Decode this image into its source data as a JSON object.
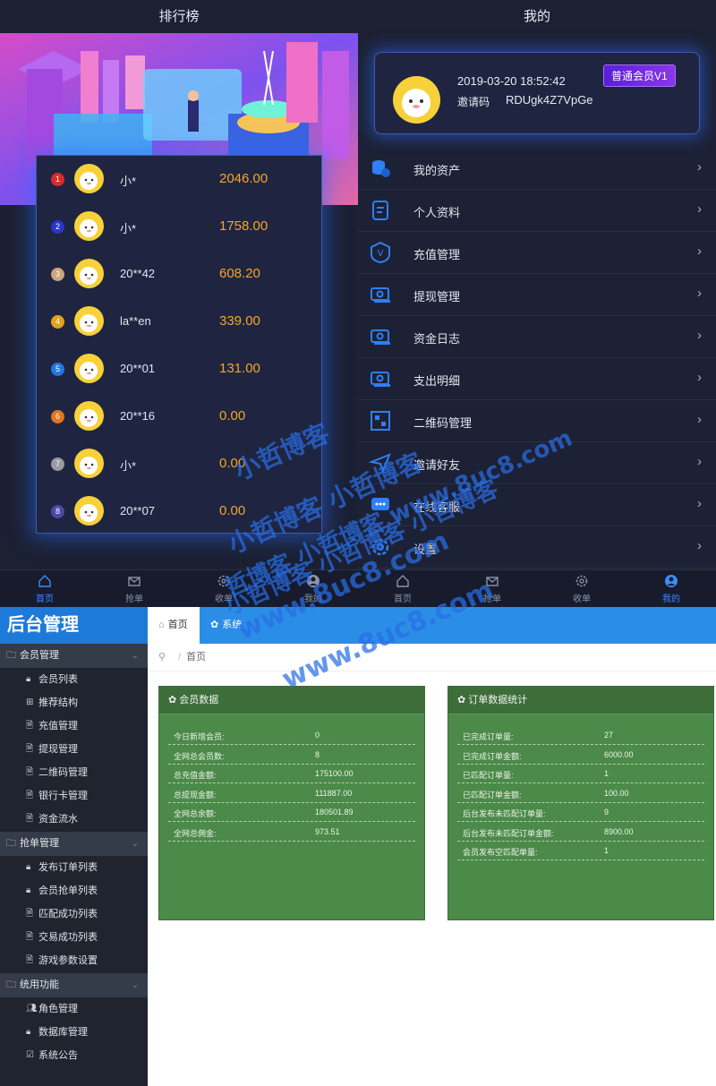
{
  "left_panel": {
    "title": "排行榜",
    "ranking": [
      {
        "rank": "1",
        "name": "小*",
        "amount": "2046.00",
        "badge_color": "#d92b2b"
      },
      {
        "rank": "2",
        "name": "小*",
        "amount": "1758.00",
        "badge_color": "#2a36c9"
      },
      {
        "rank": "3",
        "name": "20**42",
        "amount": "608.20",
        "badge_color": "#c9a57a"
      },
      {
        "rank": "4",
        "name": "la**en",
        "amount": "339.00",
        "badge_color": "#e3a21c"
      },
      {
        "rank": "5",
        "name": "20**01",
        "amount": "131.00",
        "badge_color": "#2577e3"
      },
      {
        "rank": "6",
        "name": "20**16",
        "amount": "0.00",
        "badge_color": "#e0761f"
      },
      {
        "rank": "7",
        "name": "小*",
        "amount": "0.00",
        "badge_color": "#9a9aa4"
      },
      {
        "rank": "8",
        "name": "20**07",
        "amount": "0.00",
        "badge_color": "#4b4aa8"
      }
    ]
  },
  "right_panel": {
    "title": "我的",
    "profile": {
      "datetime": "2019-03-20 18:52:42",
      "invite_label": "邀请码",
      "invite_code": "RDUgk4Z7VpGe",
      "vip": "普通会员V1"
    },
    "menu": [
      {
        "label": "我的资产",
        "icon": "coins-icon"
      },
      {
        "label": "个人资料",
        "icon": "document-icon"
      },
      {
        "label": "充值管理",
        "icon": "shield-v-icon"
      },
      {
        "label": "提现管理",
        "icon": "cash-icon"
      },
      {
        "label": "资金日志",
        "icon": "cash-icon"
      },
      {
        "label": "支出明细",
        "icon": "cash-icon"
      },
      {
        "label": "二维码管理",
        "icon": "qrcode-icon"
      },
      {
        "label": "邀请好友",
        "icon": "send-icon"
      },
      {
        "label": "在线客服",
        "icon": "chat-icon"
      },
      {
        "label": "设置",
        "icon": "gear-icon"
      }
    ],
    "arrow": "›"
  },
  "tabbar": [
    {
      "label": "首页",
      "icon": "home-icon",
      "active": true
    },
    {
      "label": "抢单",
      "icon": "mail-icon",
      "active": false
    },
    {
      "label": "收单",
      "icon": "gear-icon",
      "active": false
    },
    {
      "label": "我的",
      "icon": "user-icon",
      "active": false
    },
    {
      "label": "首页",
      "icon": "home-icon",
      "active": false
    },
    {
      "label": "抢单",
      "icon": "mail-icon",
      "active": false
    },
    {
      "label": "收单",
      "icon": "gear-icon",
      "active": false
    },
    {
      "label": "我的",
      "icon": "user-icon",
      "active": true
    }
  ],
  "admin": {
    "logo": "后台管理",
    "sidebar": [
      {
        "group": "会员管理",
        "items": [
          {
            "label": "会员列表",
            "icon": "lock-icon"
          },
          {
            "label": "推荐结构",
            "icon": "grid-icon"
          },
          {
            "label": "充值管理",
            "icon": "file-icon"
          },
          {
            "label": "提现管理",
            "icon": "file-icon"
          },
          {
            "label": "二维码管理",
            "icon": "file-icon"
          },
          {
            "label": "银行卡管理",
            "icon": "file-icon"
          },
          {
            "label": "资金流水",
            "icon": "file-icon"
          }
        ]
      },
      {
        "group": "抢单管理",
        "items": [
          {
            "label": "发布订单列表",
            "icon": "lock-icon"
          },
          {
            "label": "会员抢单列表",
            "icon": "lock-icon"
          },
          {
            "label": "匹配成功列表",
            "icon": "file-icon"
          },
          {
            "label": "交易成功列表",
            "icon": "file-icon"
          },
          {
            "label": "游戏参数设置",
            "icon": "file-icon"
          }
        ]
      },
      {
        "group": "统用功能",
        "items": [
          {
            "label": "角色管理",
            "icon": "users-icon"
          },
          {
            "label": "数据库管理",
            "icon": "lock-icon"
          },
          {
            "label": "系统公告",
            "icon": "check-icon"
          }
        ]
      }
    ],
    "tabs": {
      "home": "首页",
      "system": "系统"
    },
    "breadcrumb": "首页",
    "member_stats": {
      "title": "会员数据",
      "rows": [
        {
          "k": "今日新增会员:",
          "v": "0"
        },
        {
          "k": "全网总会员数:",
          "v": "8"
        },
        {
          "k": "总充值金额:",
          "v": "175100.00"
        },
        {
          "k": "总提现金额:",
          "v": "111887.00"
        },
        {
          "k": "全网总余额:",
          "v": "180501.89"
        },
        {
          "k": "全网总佣金:",
          "v": "973.51"
        }
      ]
    },
    "order_stats": {
      "title": "订单数据统计",
      "rows": [
        {
          "k": "已完成订单量:",
          "v": "27"
        },
        {
          "k": "已完成订单金额:",
          "v": "6000.00"
        },
        {
          "k": "已匹配订单量:",
          "v": "1"
        },
        {
          "k": "已匹配订单金额:",
          "v": "100.00"
        },
        {
          "k": "后台发布未匹配订单量:",
          "v": "9"
        },
        {
          "k": "后台发布未匹配订单金额:",
          "v": "8900.00"
        },
        {
          "k": "会员发布空匹配单量:",
          "v": "1"
        }
      ]
    }
  },
  "watermark": [
    "小哲博客",
    "小哲博客 小哲博客",
    "小哲博客 小哲博客 小哲博客",
    "哲博客 小哲博客 www.8uc8.com",
    "www.8uc8.com",
    "www.8uc8.com"
  ]
}
